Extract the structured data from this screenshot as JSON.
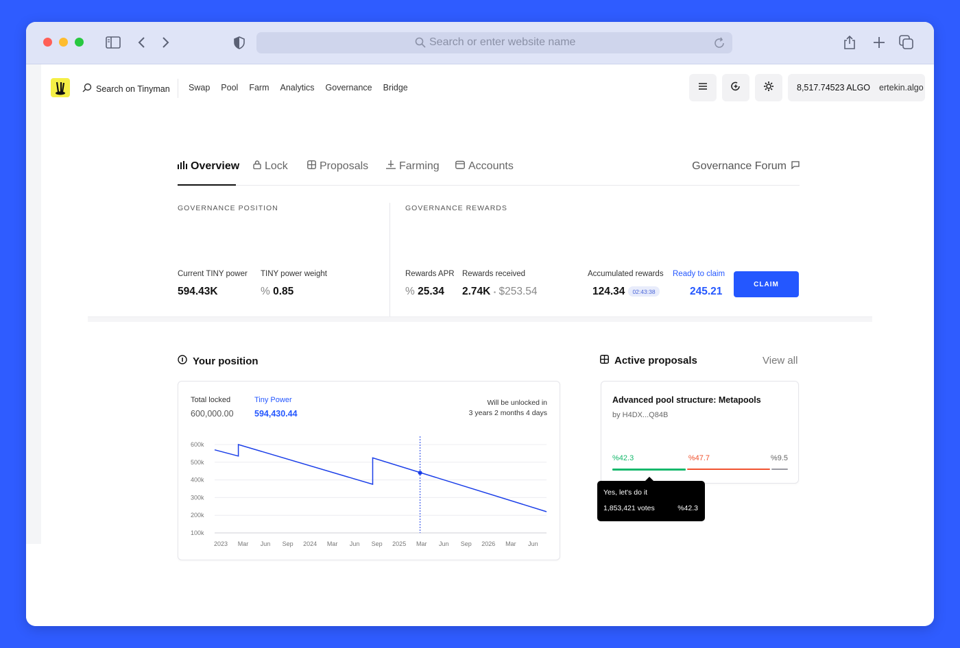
{
  "browser": {
    "url_placeholder": "Search or enter website name"
  },
  "nav": {
    "search_label": "Search on Tinyman",
    "links": [
      "Swap",
      "Pool",
      "Farm",
      "Analytics",
      "Governance",
      "Bridge"
    ],
    "balance": "8,517.74523 ALGO",
    "account": "ertekin.algo"
  },
  "tabs": [
    {
      "label": "Overview",
      "active": true
    },
    {
      "label": "Lock"
    },
    {
      "label": "Proposals"
    },
    {
      "label": "Farming"
    },
    {
      "label": "Accounts"
    }
  ],
  "forum_label": "Governance Forum",
  "position": {
    "heading": "GOVERNANCE POSITION",
    "power_label": "Current TINY power",
    "power_value": "594.43K",
    "weight_label": "TINY power weight",
    "weight_prefix": "%",
    "weight_value": "0.85"
  },
  "rewards": {
    "heading": "GOVERNANCE REWARDS",
    "apr_label": "Rewards APR",
    "apr_prefix": "%",
    "apr_value": "25.34",
    "received_label": "Rewards received",
    "received_value": "2.74K",
    "received_dot": "•",
    "received_usd": "$253.54",
    "accumulated_label": "Accumulated rewards",
    "accumulated_value": "124.34",
    "timer": "02:43:38",
    "ready_label": "Ready to claim",
    "ready_value": "245.21",
    "claim_label": "CLAIM"
  },
  "your_position": {
    "title": "Your position",
    "total_locked_label": "Total locked",
    "total_locked_value": "600,000.00",
    "tiny_power_label": "Tiny Power",
    "tiny_power_value": "594,430.44",
    "unlock_label": "Will be unlocked in",
    "unlock_value": "3 years 2 months 4 days"
  },
  "chart_data": {
    "type": "line",
    "y_ticks": [
      "600k",
      "500k",
      "400k",
      "300k",
      "200k",
      "100k"
    ],
    "x_ticks": [
      "2023",
      "Mar",
      "Jun",
      "Sep",
      "2024",
      "Mar",
      "Jun",
      "Sep",
      "2025",
      "Mar",
      "Jun",
      "Sep",
      "2026",
      "Mar",
      "Jun"
    ],
    "ylim": [
      100000,
      600000
    ],
    "series": [
      {
        "x": [
          "2023-01",
          "2023-04",
          "2023-04",
          "2024-09",
          "2024-09",
          "2026-07"
        ],
        "y": [
          570000,
          535000,
          600000,
          375000,
          525000,
          220000
        ]
      }
    ],
    "marker": {
      "x": "2025-03",
      "y": 440000
    },
    "line_color": "#1a3ee8"
  },
  "proposals": {
    "title": "Active proposals",
    "view_all": "View all",
    "item": {
      "title": "Advanced pool structure: Metapools",
      "author": "by H4DX...Q84B",
      "yes_label": "%42.3",
      "no_label": "%47.7",
      "abstain_label": "%9.5",
      "yes_pct": 42.3,
      "no_pct": 47.7,
      "abstain_pct": 9.5,
      "yes_color": "#14b86b",
      "no_color": "#f0522e",
      "abstain_color": "#9a9aa2"
    },
    "tooltip": {
      "title": "Yes, let's do it",
      "votes": "1,853,421 votes",
      "pct": "%42.3"
    }
  }
}
